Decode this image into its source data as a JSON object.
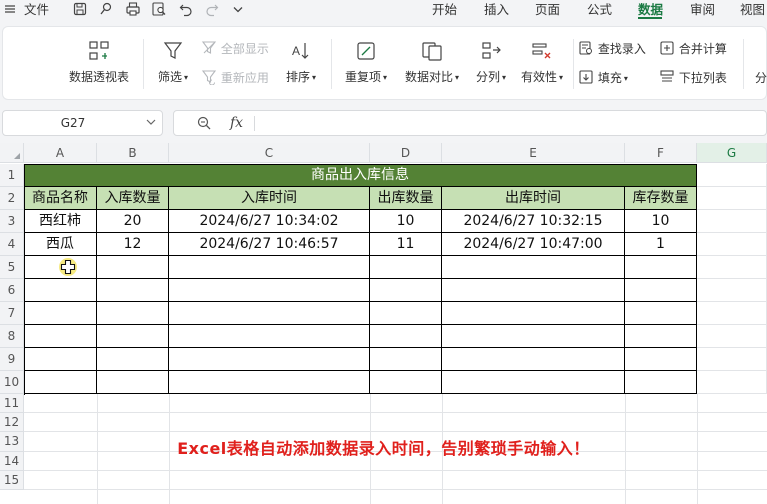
{
  "menubar": {
    "file_label": "文件",
    "tabs": [
      {
        "label": "开始",
        "active": false
      },
      {
        "label": "插入",
        "active": false
      },
      {
        "label": "页面",
        "active": false
      },
      {
        "label": "公式",
        "active": false
      },
      {
        "label": "数据",
        "active": true
      },
      {
        "label": "审阅",
        "active": false
      },
      {
        "label": "视图",
        "active": false
      }
    ],
    "quick_icons": [
      "menu-icon",
      "save-icon",
      "format-painter-icon",
      "print-icon",
      "print-preview-icon",
      "undo-icon",
      "redo-icon",
      "more-chevron-icon"
    ]
  },
  "ribbon": {
    "pivot_table": "数据透视表",
    "filter": "筛选",
    "show_all": "全部显示",
    "reapply": "重新应用",
    "sort": "排序",
    "duplicates": "重复项",
    "compare": "数据对比",
    "split": "分列",
    "validation": "有效性",
    "lookup_entry": "查找录入",
    "fill": "填充",
    "consolidate": "合并计算",
    "dropdown_list": "下拉列表",
    "cut_off": "分"
  },
  "formula_bar": {
    "cell_ref": "G27",
    "fx_label": "fx",
    "content": ""
  },
  "grid": {
    "columns": [
      "A",
      "B",
      "C",
      "D",
      "E",
      "F",
      "G"
    ],
    "selected_column": "G",
    "rows": [
      "1",
      "2",
      "3",
      "4",
      "5",
      "6",
      "7",
      "8",
      "9",
      "10",
      "11",
      "12",
      "13",
      "14",
      "15"
    ]
  },
  "table": {
    "title": "商品出入库信息",
    "headers": [
      "商品名称",
      "入库数量",
      "入库时间",
      "出库数量",
      "出库时间",
      "库存数量"
    ],
    "rows": [
      [
        "西红柿",
        "20",
        "2024/6/27 10:34:02",
        "10",
        "2024/6/27 10:32:15",
        "10"
      ],
      [
        "西瓜",
        "12",
        "2024/6/27 10:46:57",
        "11",
        "2024/6/27 10:47:00",
        "1"
      ]
    ],
    "empty_rows": 6
  },
  "caption": "Excel表格自动添加数据录入时间，告别繁琐手动输入！",
  "colors": {
    "title_fill": "#548235",
    "header_fill": "#c6e0b4",
    "accent": "#1b7a43",
    "caption": "#e0201c"
  }
}
